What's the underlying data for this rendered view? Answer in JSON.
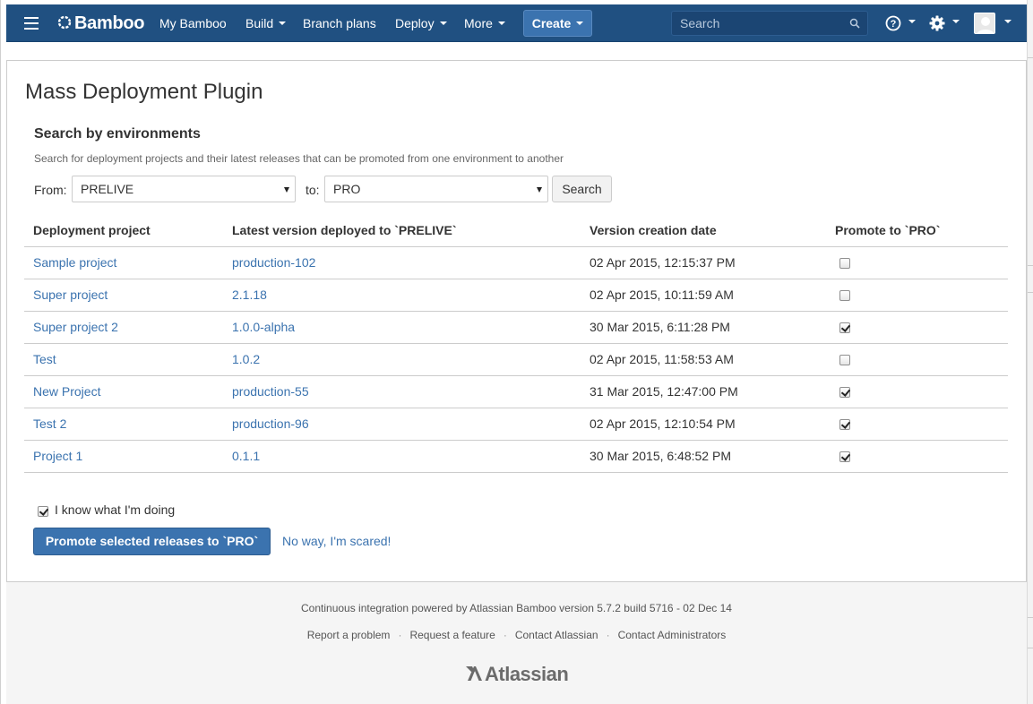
{
  "colors": {
    "header": "#205081",
    "link": "#3b73af",
    "primary_button": "#3b73af"
  },
  "header": {
    "logo_text": "Bamboo",
    "nav": [
      {
        "label": "My Bamboo",
        "has_dropdown": false
      },
      {
        "label": "Build",
        "has_dropdown": true
      },
      {
        "label": "Branch plans",
        "has_dropdown": false
      },
      {
        "label": "Deploy",
        "has_dropdown": true
      },
      {
        "label": "More",
        "has_dropdown": true
      }
    ],
    "create_label": "Create",
    "search_placeholder": "Search",
    "icons": [
      "menu-icon",
      "search-icon",
      "help-icon",
      "settings-icon",
      "avatar"
    ]
  },
  "page": {
    "title": "Mass Deployment Plugin",
    "section_title": "Search by environments",
    "section_desc": "Search for deployment projects and their latest releases that can be promoted from one environment to another",
    "from_label": "From:",
    "from_value": "PRELIVE",
    "to_label": "to:",
    "to_value": "PRO",
    "search_button": "Search"
  },
  "table": {
    "headers": [
      "Deployment project",
      "Latest version deployed to `PRELIVE`",
      "Version creation date",
      "Promote to `PRO`"
    ],
    "rows": [
      {
        "project": "Sample project",
        "version": "production-102",
        "date": "02 Apr 2015, 12:15:37 PM",
        "checked": false
      },
      {
        "project": "Super project",
        "version": "2.1.18",
        "date": "02 Apr 2015, 10:11:59 AM",
        "checked": false
      },
      {
        "project": "Super project 2",
        "version": "1.0.0-alpha",
        "date": "30 Mar 2015, 6:11:28 PM",
        "checked": true
      },
      {
        "project": "Test",
        "version": "1.0.2",
        "date": "02 Apr 2015, 11:58:53 AM",
        "checked": false
      },
      {
        "project": "New Project",
        "version": "production-55",
        "date": "31 Mar 2015, 12:47:00 PM",
        "checked": true
      },
      {
        "project": "Test 2",
        "version": "production-96",
        "date": "02 Apr 2015, 12:10:54 PM",
        "checked": true
      },
      {
        "project": "Project 1",
        "version": "0.1.1",
        "date": "30 Mar 2015, 6:48:52 PM",
        "checked": true
      }
    ]
  },
  "actions": {
    "confirm_label": "I know what I'm doing",
    "confirm_checked": true,
    "promote_button": "Promote selected releases to `PRO`",
    "cancel_link": "No way, I'm scared!"
  },
  "footer": {
    "powered_by": "Continuous integration powered by Atlassian Bamboo version 5.7.2 build 5716 - 02 Dec 14",
    "links": [
      "Report a problem",
      "Request a feature",
      "Contact Atlassian",
      "Contact Administrators"
    ],
    "logo_text": "Atlassian"
  }
}
